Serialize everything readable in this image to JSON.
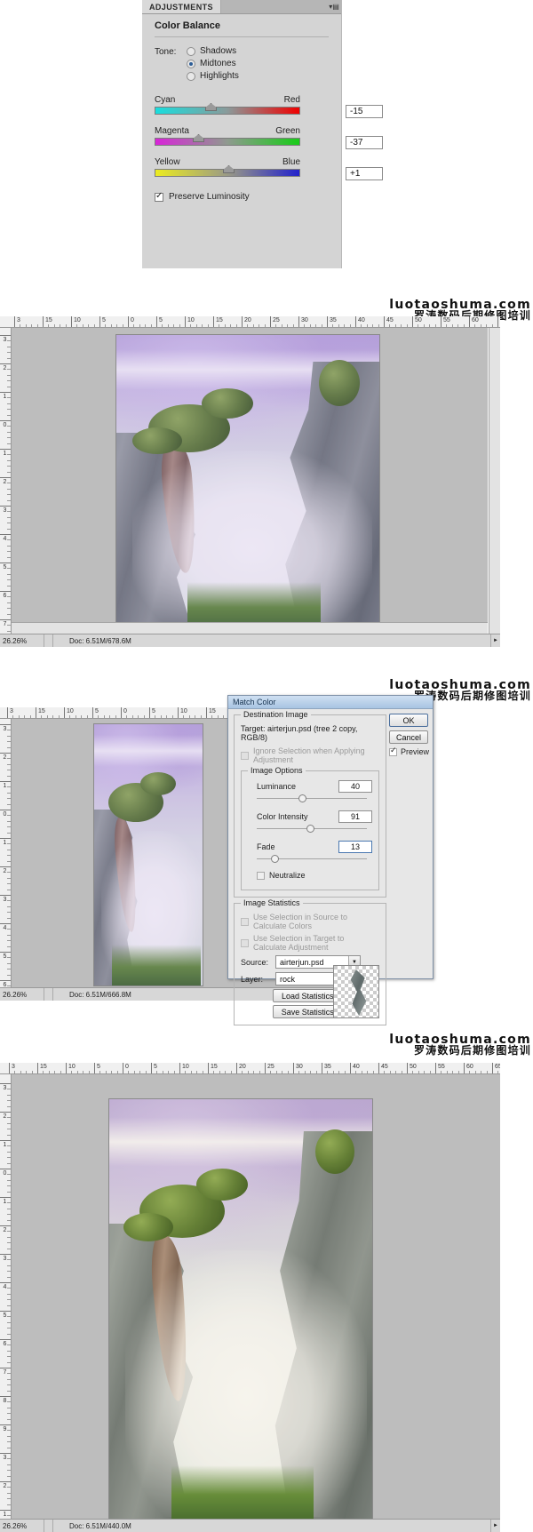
{
  "adjustments_panel": {
    "tab_label": "ADJUSTMENTS",
    "menu_icon": "panel-menu-icon",
    "title": "Color Balance",
    "tone": {
      "label": "Tone:",
      "options": [
        {
          "label": "Shadows",
          "selected": false
        },
        {
          "label": "Midtones",
          "selected": true
        },
        {
          "label": "Highlights",
          "selected": false
        }
      ]
    },
    "sliders": [
      {
        "left_label": "Cyan",
        "right_label": "Red",
        "value": "-15",
        "pos_pct": 38
      },
      {
        "left_label": "Magenta",
        "right_label": "Green",
        "value": "-37",
        "pos_pct": 30
      },
      {
        "left_label": "Yellow",
        "right_label": "Blue",
        "value": "+1",
        "pos_pct": 51
      }
    ],
    "preserve_luminosity": {
      "label": "Preserve Luminosity",
      "checked": true
    }
  },
  "watermark": {
    "english": "luotaoshuma.com",
    "chinese": "罗涛数码后期修图培训"
  },
  "ruler": {
    "horizontal_labels": [
      "3",
      "15",
      "10",
      "5",
      "0",
      "5",
      "10",
      "15",
      "20",
      "25",
      "30",
      "35",
      "40",
      "45",
      "50",
      "55",
      "60",
      "65"
    ],
    "vertical_labels": [
      "3",
      "2",
      "1",
      "0",
      "1",
      "2",
      "3",
      "4",
      "5",
      "6",
      "7",
      "8",
      "9"
    ]
  },
  "document_1": {
    "status": {
      "zoom": "26.26%",
      "doc_info": "Doc: 6.51M/678.6M",
      "scroll_left_arrow": "◄",
      "scroll_right_arrow": "►"
    }
  },
  "document_2": {
    "status": {
      "zoom": "26.26%",
      "doc_info": "Doc: 6.51M/666.8M",
      "scroll_left_arrow": "◄",
      "scroll_right_arrow": "►"
    }
  },
  "document_3": {
    "status": {
      "zoom": "26.26%",
      "doc_info": "Doc: 6.51M/440.0M",
      "scroll_left_arrow": "◄",
      "scroll_right_arrow": "►"
    }
  },
  "match_color_dialog": {
    "title": "Match Color",
    "destination_image": {
      "group_label": "Destination Image",
      "target_label": "Target:",
      "target_value": "airterjun.psd (tree 2 copy, RGB/8)",
      "ignore_selection": {
        "label": "Ignore Selection when Applying Adjustment",
        "checked": false,
        "disabled": true
      }
    },
    "image_options": {
      "group_label": "Image Options",
      "luminance": {
        "label": "Luminance",
        "value": "40",
        "pos_pct": 40
      },
      "color_intensity": {
        "label": "Color Intensity",
        "value": "91",
        "pos_pct": 46
      },
      "fade": {
        "label": "Fade",
        "value": "13",
        "pos_pct": 14
      },
      "neutralize": {
        "label": "Neutralize",
        "checked": false
      }
    },
    "image_statistics": {
      "group_label": "Image Statistics",
      "use_selection_source": {
        "label": "Use Selection in Source to Calculate Colors",
        "checked": false,
        "disabled": true
      },
      "use_selection_target": {
        "label": "Use Selection in Target to Calculate Adjustment",
        "checked": false,
        "disabled": true
      },
      "source": {
        "label": "Source:",
        "value": "airterjun.psd"
      },
      "layer": {
        "label": "Layer:",
        "value": "rock"
      },
      "load_statistics": "Load Statistics...",
      "save_statistics": "Save Statistics..."
    },
    "buttons": {
      "ok": "OK",
      "cancel": "Cancel",
      "preview": {
        "label": "Preview",
        "checked": true
      }
    }
  }
}
